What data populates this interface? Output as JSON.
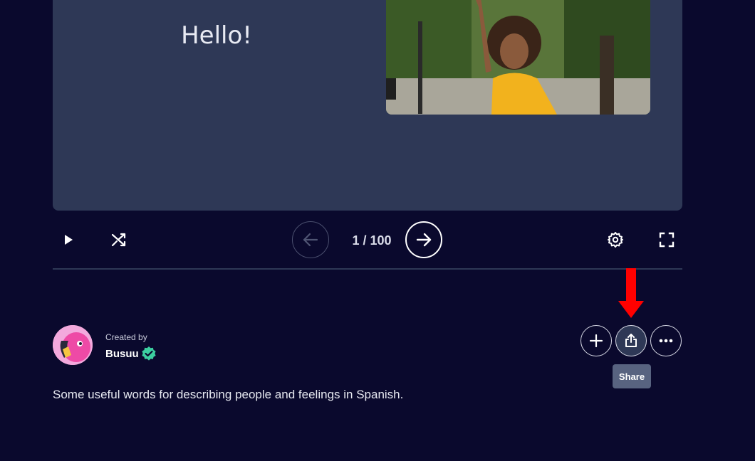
{
  "card": {
    "term": "Hello!",
    "image": "smiling-woman-photo"
  },
  "controls": {
    "counter": "1 / 100",
    "icons": {
      "play": "play-icon",
      "shuffle": "shuffle-icon",
      "prev": "arrow-left-icon",
      "next": "arrow-right-icon",
      "settings": "gear-icon",
      "fullscreen": "fullscreen-icon"
    }
  },
  "creator": {
    "label": "Created by",
    "name": "Busuu",
    "verified": true
  },
  "actions": {
    "add": "plus-icon",
    "share": "share-icon",
    "more": "more-icon",
    "tooltip": "Share"
  },
  "description": "Some useful words for describing people and feelings in Spanish.",
  "colors": {
    "background": "#0a092d",
    "card": "#2e3856",
    "tooltip": "#586380",
    "annotation": "#ff0000",
    "verified": "#3ccfa0"
  }
}
